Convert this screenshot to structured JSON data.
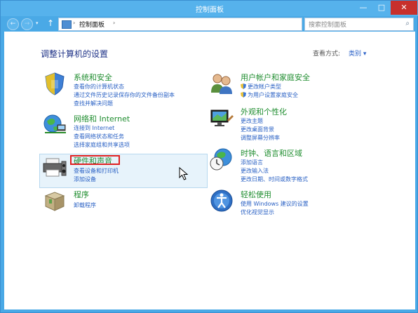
{
  "window": {
    "title": "控制面板",
    "controls": {
      "minimize": "—",
      "maximize": "□",
      "close": "✕"
    }
  },
  "toolbar": {
    "back_icon": "←",
    "forward_icon": "→",
    "recent_icon": "▾",
    "up_icon": "↑",
    "address": {
      "chevron": "›",
      "path": "控制面板",
      "chevron2": "›",
      "dropdown": "▾",
      "refresh": "↻"
    },
    "search": {
      "placeholder": "搜索控制面板",
      "icon": "⌕"
    }
  },
  "content": {
    "title": "调整计算机的设置",
    "view_by": {
      "label": "查看方式:",
      "value": "类别 ▾"
    },
    "categories": [
      {
        "title": "系统和安全",
        "icon": "shield-icon",
        "links": [
          "查看你的计算机状态",
          "通过文件历史记录保存你的文件备份副本",
          "查找并解决问题"
        ]
      },
      {
        "title": "网络和 Internet",
        "icon": "globe-network-icon",
        "links": [
          "连接到 Internet",
          "查看网络状态和任务",
          "选择家庭组和共享选项"
        ]
      },
      {
        "title": "硬件和声音",
        "icon": "printer-icon",
        "links": [
          "查看设备和打印机",
          "添加设备"
        ]
      },
      {
        "title": "程序",
        "icon": "programs-box-icon",
        "links": [
          "卸载程序"
        ]
      },
      {
        "title": "用户帐户和家庭安全",
        "icon": "users-icon",
        "links": [
          "更改帐户类型",
          "为用户设置家庭安全"
        ]
      },
      {
        "title": "外观和个性化",
        "icon": "monitor-icon",
        "links": [
          "更改主题",
          "更改桌面背景",
          "调整屏幕分辨率"
        ]
      },
      {
        "title": "时钟、语言和区域",
        "icon": "globe-clock-icon",
        "links": [
          "添加语言",
          "更改输入法",
          "更改日期、时间或数字格式"
        ]
      },
      {
        "title": "轻松使用",
        "icon": "ease-of-access-icon",
        "links": [
          "使用 Windows 建议的设置",
          "优化视觉显示"
        ]
      }
    ]
  }
}
